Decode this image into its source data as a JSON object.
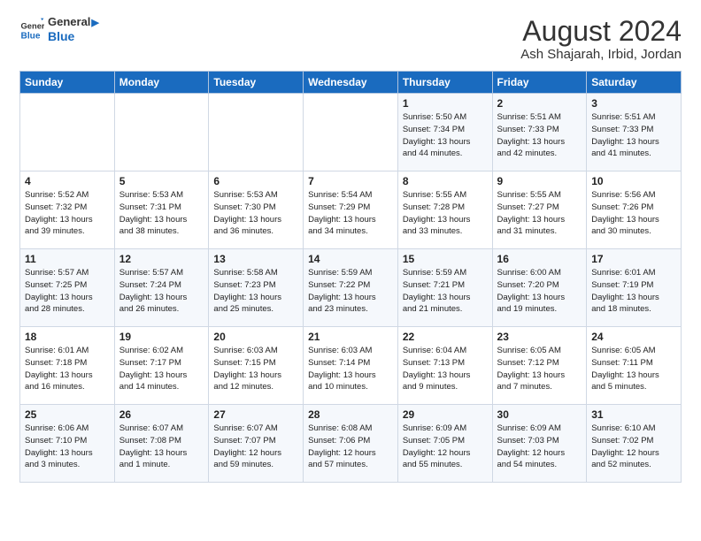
{
  "header": {
    "logo_line1": "General",
    "logo_line2": "Blue",
    "month_year": "August 2024",
    "location": "Ash Shajarah, Irbid, Jordan"
  },
  "weekdays": [
    "Sunday",
    "Monday",
    "Tuesday",
    "Wednesday",
    "Thursday",
    "Friday",
    "Saturday"
  ],
  "weeks": [
    [
      {
        "day": "",
        "info": ""
      },
      {
        "day": "",
        "info": ""
      },
      {
        "day": "",
        "info": ""
      },
      {
        "day": "",
        "info": ""
      },
      {
        "day": "1",
        "info": "Sunrise: 5:50 AM\nSunset: 7:34 PM\nDaylight: 13 hours\nand 44 minutes."
      },
      {
        "day": "2",
        "info": "Sunrise: 5:51 AM\nSunset: 7:33 PM\nDaylight: 13 hours\nand 42 minutes."
      },
      {
        "day": "3",
        "info": "Sunrise: 5:51 AM\nSunset: 7:33 PM\nDaylight: 13 hours\nand 41 minutes."
      }
    ],
    [
      {
        "day": "4",
        "info": "Sunrise: 5:52 AM\nSunset: 7:32 PM\nDaylight: 13 hours\nand 39 minutes."
      },
      {
        "day": "5",
        "info": "Sunrise: 5:53 AM\nSunset: 7:31 PM\nDaylight: 13 hours\nand 38 minutes."
      },
      {
        "day": "6",
        "info": "Sunrise: 5:53 AM\nSunset: 7:30 PM\nDaylight: 13 hours\nand 36 minutes."
      },
      {
        "day": "7",
        "info": "Sunrise: 5:54 AM\nSunset: 7:29 PM\nDaylight: 13 hours\nand 34 minutes."
      },
      {
        "day": "8",
        "info": "Sunrise: 5:55 AM\nSunset: 7:28 PM\nDaylight: 13 hours\nand 33 minutes."
      },
      {
        "day": "9",
        "info": "Sunrise: 5:55 AM\nSunset: 7:27 PM\nDaylight: 13 hours\nand 31 minutes."
      },
      {
        "day": "10",
        "info": "Sunrise: 5:56 AM\nSunset: 7:26 PM\nDaylight: 13 hours\nand 30 minutes."
      }
    ],
    [
      {
        "day": "11",
        "info": "Sunrise: 5:57 AM\nSunset: 7:25 PM\nDaylight: 13 hours\nand 28 minutes."
      },
      {
        "day": "12",
        "info": "Sunrise: 5:57 AM\nSunset: 7:24 PM\nDaylight: 13 hours\nand 26 minutes."
      },
      {
        "day": "13",
        "info": "Sunrise: 5:58 AM\nSunset: 7:23 PM\nDaylight: 13 hours\nand 25 minutes."
      },
      {
        "day": "14",
        "info": "Sunrise: 5:59 AM\nSunset: 7:22 PM\nDaylight: 13 hours\nand 23 minutes."
      },
      {
        "day": "15",
        "info": "Sunrise: 5:59 AM\nSunset: 7:21 PM\nDaylight: 13 hours\nand 21 minutes."
      },
      {
        "day": "16",
        "info": "Sunrise: 6:00 AM\nSunset: 7:20 PM\nDaylight: 13 hours\nand 19 minutes."
      },
      {
        "day": "17",
        "info": "Sunrise: 6:01 AM\nSunset: 7:19 PM\nDaylight: 13 hours\nand 18 minutes."
      }
    ],
    [
      {
        "day": "18",
        "info": "Sunrise: 6:01 AM\nSunset: 7:18 PM\nDaylight: 13 hours\nand 16 minutes."
      },
      {
        "day": "19",
        "info": "Sunrise: 6:02 AM\nSunset: 7:17 PM\nDaylight: 13 hours\nand 14 minutes."
      },
      {
        "day": "20",
        "info": "Sunrise: 6:03 AM\nSunset: 7:15 PM\nDaylight: 13 hours\nand 12 minutes."
      },
      {
        "day": "21",
        "info": "Sunrise: 6:03 AM\nSunset: 7:14 PM\nDaylight: 13 hours\nand 10 minutes."
      },
      {
        "day": "22",
        "info": "Sunrise: 6:04 AM\nSunset: 7:13 PM\nDaylight: 13 hours\nand 9 minutes."
      },
      {
        "day": "23",
        "info": "Sunrise: 6:05 AM\nSunset: 7:12 PM\nDaylight: 13 hours\nand 7 minutes."
      },
      {
        "day": "24",
        "info": "Sunrise: 6:05 AM\nSunset: 7:11 PM\nDaylight: 13 hours\nand 5 minutes."
      }
    ],
    [
      {
        "day": "25",
        "info": "Sunrise: 6:06 AM\nSunset: 7:10 PM\nDaylight: 13 hours\nand 3 minutes."
      },
      {
        "day": "26",
        "info": "Sunrise: 6:07 AM\nSunset: 7:08 PM\nDaylight: 13 hours\nand 1 minute."
      },
      {
        "day": "27",
        "info": "Sunrise: 6:07 AM\nSunset: 7:07 PM\nDaylight: 12 hours\nand 59 minutes."
      },
      {
        "day": "28",
        "info": "Sunrise: 6:08 AM\nSunset: 7:06 PM\nDaylight: 12 hours\nand 57 minutes."
      },
      {
        "day": "29",
        "info": "Sunrise: 6:09 AM\nSunset: 7:05 PM\nDaylight: 12 hours\nand 55 minutes."
      },
      {
        "day": "30",
        "info": "Sunrise: 6:09 AM\nSunset: 7:03 PM\nDaylight: 12 hours\nand 54 minutes."
      },
      {
        "day": "31",
        "info": "Sunrise: 6:10 AM\nSunset: 7:02 PM\nDaylight: 12 hours\nand 52 minutes."
      }
    ]
  ]
}
